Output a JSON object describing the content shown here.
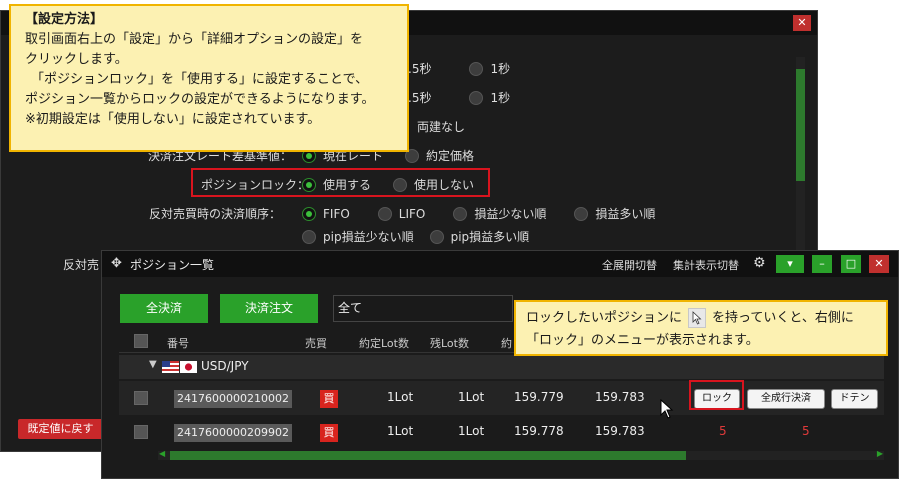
{
  "settings_dialog": {
    "close_glyph": "✕",
    "rows": {
      "row1": {
        "opt_a": ".5秒",
        "opt_b": "1秒"
      },
      "row2": {
        "opt_a": ".5秒",
        "opt_b": "1秒"
      },
      "row3": {
        "opt_b": "両建なし"
      },
      "settle_rate": {
        "label": "決済注文レート差基準値：",
        "opt_a": "現在レート",
        "opt_b": "約定価格"
      },
      "position_lock": {
        "label": "ポジションロック：",
        "opt_on": "使用する",
        "opt_off": "使用しない",
        "selected": "使用する"
      },
      "settle_order": {
        "label": "反対売買時の決済順序：",
        "options": [
          "FIFO",
          "LIFO",
          "損益少ない順",
          "損益多い順",
          "pip損益少ない順",
          "pip損益多い順"
        ],
        "selected": "FIFO"
      },
      "partial_label": "反対売"
    },
    "reset_button": "既定値に戻す"
  },
  "callout_main": {
    "title": "【設定方法】",
    "lines": [
      "取引画面右上の「設定」から「詳細オプションの設定」を",
      "クリックします。",
      "「ポジションロック」を「使用する」に設定することで、",
      "ポジション一覧からロックの設定ができるようになります。",
      "※初期設定は「使用しない」に設定されています。"
    ]
  },
  "callout_menu": {
    "line1_before": "ロックしたいポジションに",
    "line1_after": "を持っていくと、右側に",
    "line2": "「ロック」のメニューが表示されます。",
    "icon": "hand-cursor-icon"
  },
  "position_panel": {
    "move_glyph": "✥",
    "title": "ポジション一覧",
    "expand_toggle": "全展開切替",
    "summary_toggle": "集計表示切替",
    "gear_glyph": "⚙",
    "window_glyphs": {
      "menu": "▾",
      "min": "–",
      "max": "□",
      "close": "✕"
    },
    "close_all_button": "全決済",
    "settle_order_button": "決済注文",
    "filter_value": "全て",
    "columns": [
      "番号",
      "売買",
      "約定Lot数",
      "残Lot数",
      "約"
    ],
    "group": {
      "expand_glyph": "▼",
      "label": "USD/JPY"
    },
    "rows": [
      {
        "id": "2417600000210002",
        "side": "買",
        "lot": "1Lot",
        "remaining": "1Lot",
        "price_a": "159.779",
        "price_b": "159.783"
      },
      {
        "id": "2417600000209902",
        "side": "買",
        "lot": "1Lot",
        "remaining": "1Lot",
        "price_a": "159.778",
        "price_b": "159.783",
        "val_a": "5",
        "val_b": "5"
      }
    ],
    "row_actions": {
      "lock": "ロック",
      "market_close": "全成行決済",
      "doten": "ドテン"
    },
    "scroll_left": "◀",
    "scroll_right": "▶"
  },
  "colors": {
    "accent_green": "#2aa12a",
    "alert_red": "#d8141e",
    "callout_bg": "#fcf1b2",
    "callout_border": "#f0b400"
  }
}
